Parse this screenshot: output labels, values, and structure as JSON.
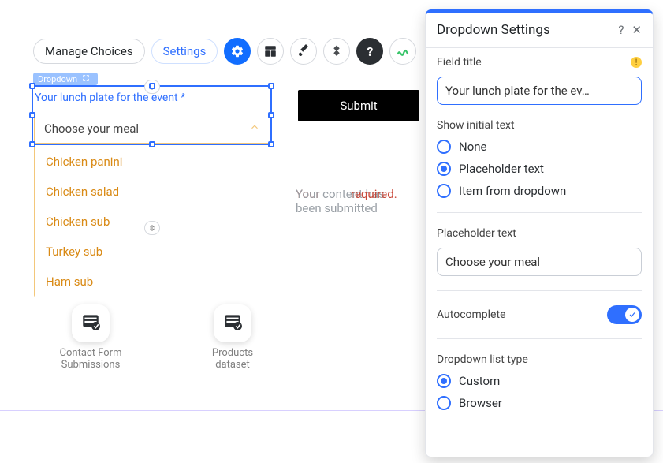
{
  "toolbar": {
    "manage_choices": "Manage Choices",
    "settings": "Settings"
  },
  "component": {
    "label": "Dropdown",
    "field_label": "Your lunch plate for the event",
    "required_mark": "*",
    "placeholder": "Choose your meal",
    "options": [
      "Chicken panini",
      "Chicken salad",
      "Chicken sub",
      "Turkey sub",
      "Ham sub"
    ]
  },
  "submit": {
    "label": "Submit"
  },
  "status": {
    "line1_a": "Your ",
    "line1_b": "content has ",
    "line1_red_cont": "required.",
    "line2": "been submitted"
  },
  "datasets": [
    {
      "title": [
        "Contact Form",
        "Submissions"
      ]
    },
    {
      "title": [
        "Products",
        "dataset"
      ]
    }
  ],
  "panel": {
    "title": "Dropdown Settings",
    "field_title_label": "Field title",
    "field_title_value": "Your lunch plate for the ev…",
    "show_initial_label": "Show initial text",
    "show_initial_options": {
      "none": "None",
      "placeholder": "Placeholder text",
      "item": "Item from dropdown"
    },
    "placeholder_label": "Placeholder text",
    "placeholder_value": "Choose your meal",
    "autocomplete_label": "Autocomplete",
    "autocomplete_on": true,
    "list_type_label": "Dropdown list type",
    "list_type_options": {
      "custom": "Custom",
      "browser": "Browser"
    }
  }
}
